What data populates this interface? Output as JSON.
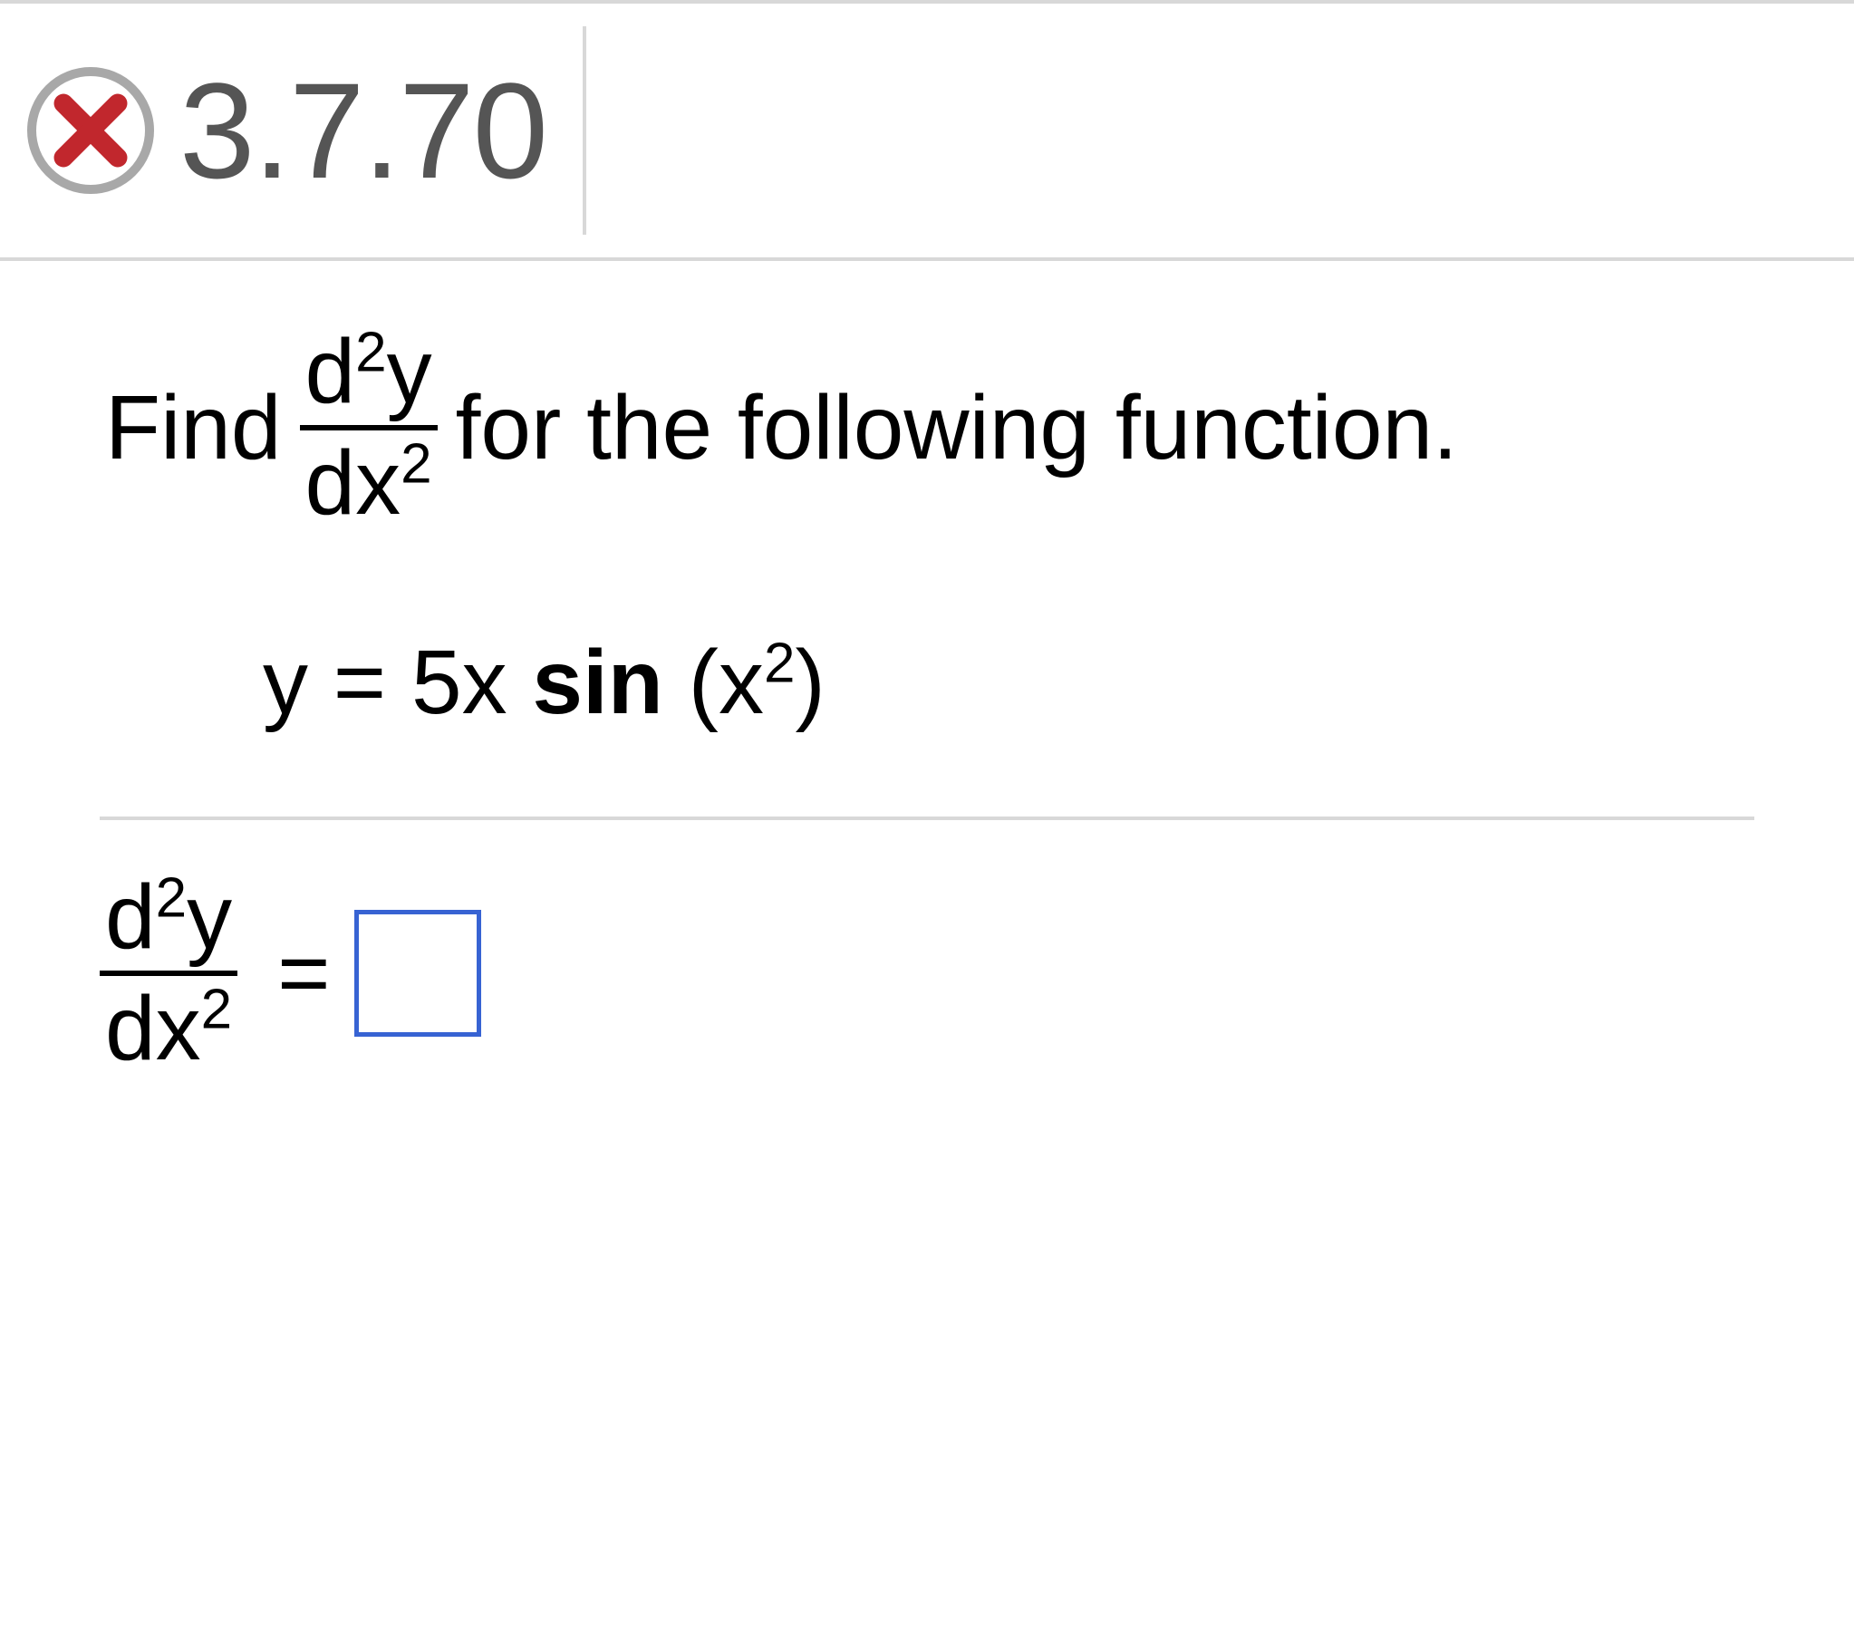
{
  "header": {
    "status": "incorrect",
    "problem_number": "3.7.70"
  },
  "question": {
    "prefix": "Find",
    "derivative": {
      "numerator_base": "d",
      "numerator_exp": "2",
      "numerator_var": "y",
      "denom_base": "dx",
      "denom_exp": "2"
    },
    "suffix": "for the following function."
  },
  "equation": {
    "lhs": "y",
    "eq": " = ",
    "coef": "5x",
    "space": " ",
    "func": "sin",
    "space2": " ",
    "open": "(x",
    "arg_exp": "2",
    "close": ")"
  },
  "answer": {
    "derivative": {
      "numerator_base": "d",
      "numerator_exp": "2",
      "numerator_var": "y",
      "denom_base": "dx",
      "denom_exp": "2"
    },
    "eq": "=",
    "input_value": ""
  }
}
